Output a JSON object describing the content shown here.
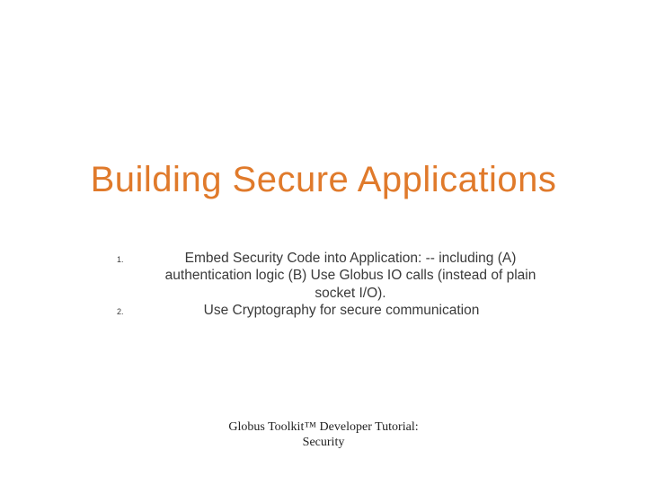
{
  "title": "Building Secure Applications",
  "list": {
    "items": [
      {
        "num": "1.",
        "text": "Embed Security Code into Application: -- including (A) authentication logic (B) Use Globus IO calls (instead of plain socket I/O)."
      },
      {
        "num": "2.",
        "text": "Use Cryptography for secure communication"
      }
    ]
  },
  "footer": {
    "line1": "Globus Toolkit™ Developer Tutorial:",
    "line2": "Security"
  }
}
